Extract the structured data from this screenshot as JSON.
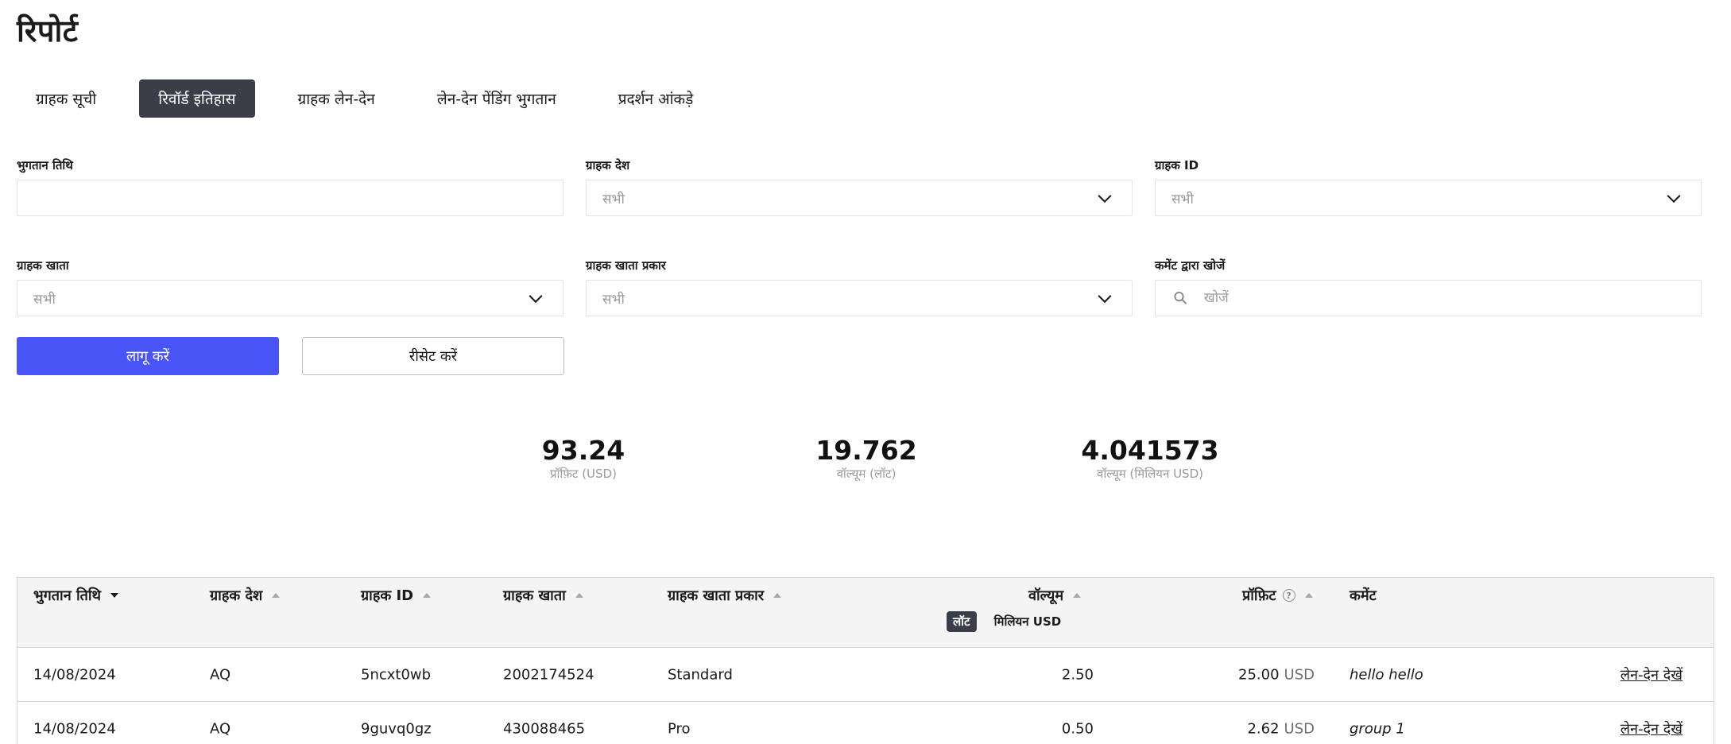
{
  "page": {
    "title": "रिपोर्ट"
  },
  "tabs": [
    {
      "label": "ग्राहक सूची",
      "active": false
    },
    {
      "label": "रिवॉर्ड इतिहास",
      "active": true
    },
    {
      "label": "ग्राहक लेन-देन",
      "active": false
    },
    {
      "label": "लेन-देन पेंडिंग भुगतान",
      "active": false
    },
    {
      "label": "प्रदर्शन आंकड़े",
      "active": false
    }
  ],
  "filters": {
    "payment_date": {
      "label": "भुगतान तिथि",
      "value": ""
    },
    "client_country": {
      "label": "ग्राहक देश",
      "value": "सभी"
    },
    "client_id": {
      "label": "ग्राहक ID",
      "value": "सभी"
    },
    "client_account": {
      "label": "ग्राहक खाता",
      "value": "सभी"
    },
    "client_account_type": {
      "label": "ग्राहक खाता प्रकार",
      "value": "सभी"
    },
    "comment_search": {
      "label": "कमेंट द्वारा खोजें",
      "placeholder": "खोजें",
      "value": ""
    }
  },
  "actions": {
    "apply": "लागू करें",
    "reset": "रीसेट करें"
  },
  "stats": {
    "profit": {
      "value": "93.24",
      "label": "प्रॉफ़िट (USD)"
    },
    "volume_lots": {
      "value": "19.762",
      "label": "वॉल्यूम (लॉट)"
    },
    "volume_musd": {
      "value": "4.041573",
      "label": "वॉल्यूम (मिलियन USD)"
    }
  },
  "table": {
    "headers": {
      "payment_date": "भुगतान तिथि",
      "client_country": "ग्राहक देश",
      "client_id": "ग्राहक ID",
      "client_account": "ग्राहक खाता",
      "client_account_type": "ग्राहक खाता प्रकार",
      "volume": "वॉल्यूम",
      "profit": "प्रॉफ़िट",
      "comment": "कमेंट"
    },
    "volume_units": {
      "lots": "लॉट",
      "musd": "मिलियन USD",
      "selected": "lots"
    },
    "currency": "USD",
    "view_link": "लेन-देन देखें",
    "rows": [
      {
        "date": "14/08/2024",
        "country": "AQ",
        "id": "5ncxt0wb",
        "account": "2002174524",
        "type": "Standard",
        "volume": "2.50",
        "profit": "25.00",
        "comment": "hello hello"
      },
      {
        "date": "14/08/2024",
        "country": "AQ",
        "id": "9guvq0gz",
        "account": "430088465",
        "type": "Pro",
        "volume": "0.50",
        "profit": "2.62",
        "comment": "group 1"
      }
    ]
  }
}
